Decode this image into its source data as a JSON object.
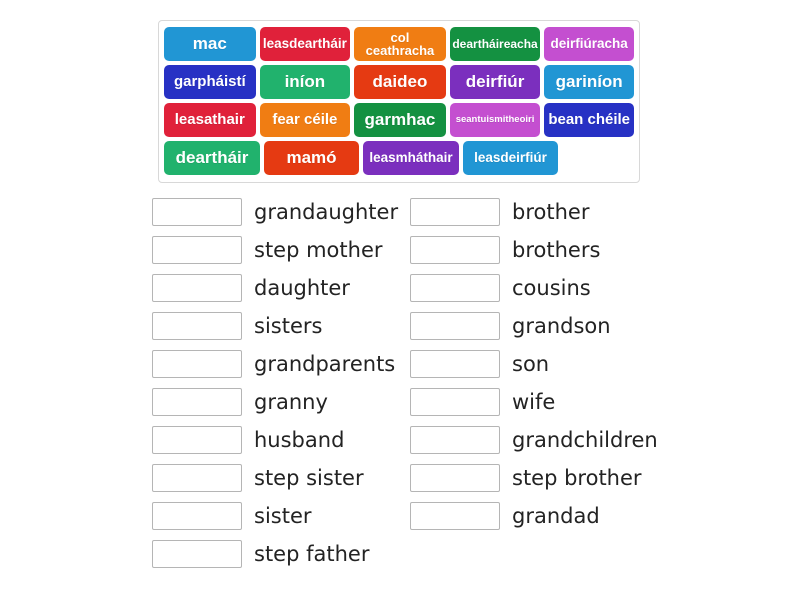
{
  "word_bank": {
    "name": "word-bank",
    "rows": [
      [
        {
          "label": "mac",
          "color": "#2196d4"
        },
        {
          "label": "leasdeartháir",
          "color": "#e0213a"
        },
        {
          "label": "col ceathracha",
          "color": "#f07d13"
        },
        {
          "label": "deartháireacha",
          "color": "#149141"
        },
        {
          "label": "deirfiúracha",
          "color": "#c44fd0"
        }
      ],
      [
        {
          "label": "garpháistí",
          "color": "#2731c4"
        },
        {
          "label": "iníon",
          "color": "#21b26d"
        },
        {
          "label": "daideo",
          "color": "#e53a12"
        },
        {
          "label": "deirfiúr",
          "color": "#7b2fbe"
        },
        {
          "label": "gariníon",
          "color": "#2196d4"
        }
      ],
      [
        {
          "label": "leasathair",
          "color": "#e0213a"
        },
        {
          "label": "fear céile",
          "color": "#f07d13"
        },
        {
          "label": "garmhac",
          "color": "#149141"
        },
        {
          "label": "seantuismitheoiri",
          "color": "#c44fd0"
        },
        {
          "label": "bean chéile",
          "color": "#2731c4"
        }
      ],
      [
        {
          "label": "deartháir",
          "color": "#21b26d"
        },
        {
          "label": "mamó",
          "color": "#e53a12"
        },
        {
          "label": "leasmháthair",
          "color": "#7b2fbe"
        },
        {
          "label": "leasdeirfiúr",
          "color": "#2196d4"
        }
      ]
    ]
  },
  "answers": {
    "left_column": [
      {
        "label": "grandaughter",
        "value": ""
      },
      {
        "label": "step mother",
        "value": ""
      },
      {
        "label": "daughter",
        "value": ""
      },
      {
        "label": "sisters",
        "value": ""
      },
      {
        "label": "grandparents",
        "value": ""
      },
      {
        "label": "granny",
        "value": ""
      },
      {
        "label": "husband",
        "value": ""
      },
      {
        "label": "step sister",
        "value": ""
      },
      {
        "label": "sister",
        "value": ""
      },
      {
        "label": "step father",
        "value": ""
      }
    ],
    "right_column": [
      {
        "label": "brother",
        "value": ""
      },
      {
        "label": "brothers",
        "value": ""
      },
      {
        "label": "cousins",
        "value": ""
      },
      {
        "label": "grandson",
        "value": ""
      },
      {
        "label": "son",
        "value": ""
      },
      {
        "label": "wife",
        "value": ""
      },
      {
        "label": "grandchildren",
        "value": ""
      },
      {
        "label": "step brother",
        "value": ""
      },
      {
        "label": "grandad",
        "value": ""
      }
    ]
  }
}
